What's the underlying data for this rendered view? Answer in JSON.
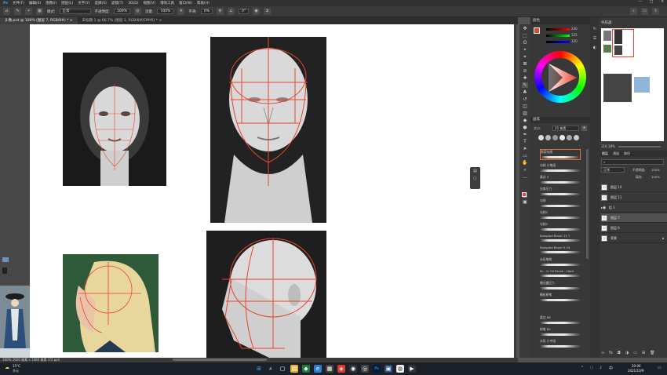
{
  "menu": {
    "items": [
      "文件(F)",
      "编辑(E)",
      "图像(I)",
      "图层(L)",
      "文字(Y)",
      "选择(S)",
      "滤镜(T)",
      "3D(D)",
      "视图(V)",
      "增效工具",
      "窗口(W)",
      "帮助(H)"
    ]
  },
  "window_controls": {
    "minimize": "—",
    "maximize": "□",
    "close": "✕"
  },
  "options": {
    "mode_label": "模式:",
    "mode_value": "正常",
    "opacity_label": "不透明度:",
    "opacity_value": "100%",
    "flow_label": "流量:",
    "flow_value": "100%",
    "smooth_label": "平滑:",
    "smooth_value": "0%",
    "angle_value": "0°"
  },
  "tabs": [
    {
      "label": "头像.psd @ 100% (图层 7, RGB/8#) * ×"
    },
    {
      "label": "未标题-1 @ 66.7% (图层 1, RGB/8#/CMYK) * ×"
    }
  ],
  "status": {
    "text": "100% 1920 像素 x 1080 像素 (72 ppi)"
  },
  "color_panel": {
    "title": "颜色",
    "r": "230",
    "g": "125",
    "b": "120"
  },
  "brush_panel": {
    "title": "画笔",
    "size_label": "大小:",
    "size_value": "25 像素",
    "brushes": [
      {
        "name": "常用勾线"
      },
      {
        "name": "勾线 小笔画"
      },
      {
        "name": "柔边 3"
      },
      {
        "name": "尖角压力"
      },
      {
        "name": "勾线"
      },
      {
        "name": "勾线2"
      },
      {
        "name": "勾线3"
      },
      {
        "name": "Sampled Brush 15 7"
      },
      {
        "name": "Sampled Brush 9 24"
      },
      {
        "name": "水彩笔刷"
      },
      {
        "name": "KL - IL Oil Brush - Hard"
      },
      {
        "name": "硬边圆压力"
      },
      {
        "name": "颗粒粉笔"
      },
      {
        "name": "柔边 88"
      },
      {
        "name": "粉笔 60"
      },
      {
        "name": "水彩 小中画"
      }
    ]
  },
  "nav_panel": {
    "title": "导航器"
  },
  "layers_panel": {
    "tabs": [
      "图层",
      "通道",
      "路径"
    ],
    "blend": "正常",
    "opacity_label": "不透明度:",
    "opacity_value": "100%",
    "fill_label": "填充:",
    "fill_value": "100%",
    "zoom": "116.18%",
    "layers": [
      {
        "name": "图层 14"
      },
      {
        "name": "图层 11"
      },
      {
        "name": "组 1"
      },
      {
        "name": "图层 7"
      },
      {
        "name": "图层 6"
      },
      {
        "name": "背景"
      }
    ]
  },
  "taskbar": {
    "weather_temp": "15°C",
    "weather_desc": "多云",
    "time": "20:06",
    "date": "2021/10/9"
  },
  "colors": {
    "accent_red": "#e8452f",
    "ps_dark": "#383838",
    "selection": "#e96a3b"
  }
}
